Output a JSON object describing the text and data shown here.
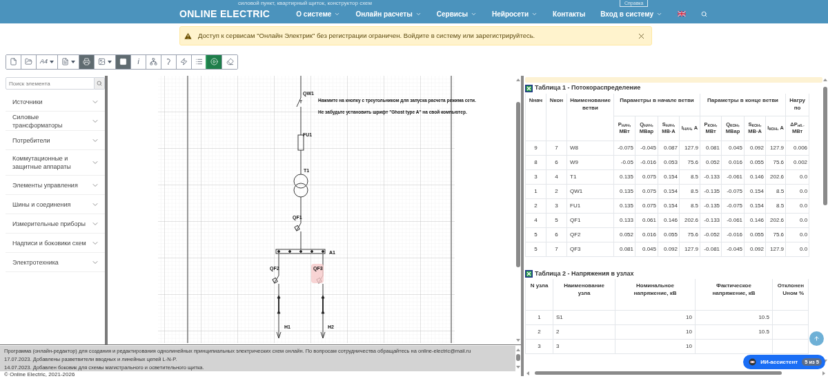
{
  "behind_header": {
    "text": "силовой пункт, квартирный щиток, конструктор схем",
    "button": "Справка"
  },
  "nav": {
    "logo": "ONLINE ELECTRIC",
    "items": [
      {
        "kind": "link",
        "label": "О системе",
        "dropdown": true
      },
      {
        "kind": "link",
        "label": "Онлайн расчеты",
        "dropdown": true
      },
      {
        "kind": "link",
        "label": "Сервисы",
        "dropdown": true
      },
      {
        "kind": "link",
        "label": "Нейросети",
        "dropdown": true
      },
      {
        "kind": "link",
        "label": "Контакты",
        "dropdown": false
      },
      {
        "kind": "link",
        "label": "Вход в систему",
        "dropdown": true
      },
      {
        "kind": "flag"
      },
      {
        "kind": "search"
      }
    ]
  },
  "alert": {
    "text": "Доступ к сервисам \"Онлайн Электрик\" без регистрации ограничен. Войдите в систему или зарегистрируйтесь."
  },
  "toolbar": [
    {
      "kind": "icon",
      "selected": false,
      "dropdown": false
    },
    {
      "kind": "icon",
      "selected": false,
      "dropdown": false
    },
    {
      "kind": "text",
      "label": "A4",
      "selected": false,
      "dropdown": true
    },
    {
      "kind": "icon",
      "selected": false,
      "dropdown": true
    },
    {
      "kind": "icon",
      "selected": true,
      "dropdown": false
    },
    {
      "kind": "icon",
      "selected": false,
      "dropdown": true
    },
    {
      "kind": "icon",
      "selected": true,
      "dropdown": false
    },
    {
      "kind": "text",
      "label": "i",
      "selected": false,
      "dropdown": false
    },
    {
      "kind": "icon",
      "selected": false,
      "dropdown": false
    },
    {
      "kind": "icon",
      "selected": false,
      "dropdown": false
    },
    {
      "kind": "icon",
      "selected": false,
      "dropdown": false
    },
    {
      "kind": "icon",
      "selected": false,
      "dropdown": false
    },
    {
      "kind": "run",
      "selected": true,
      "dropdown": false
    },
    {
      "kind": "icon",
      "selected": false,
      "dropdown": false
    }
  ],
  "sidebar": {
    "search_placeholder": "Поиск элемента",
    "items": [
      {
        "label": "Источники",
        "expanded": false
      },
      {
        "label": "Силовые трансформаторы",
        "expanded": false
      },
      {
        "label": "Потребители",
        "expanded": false
      },
      {
        "label": "Коммутационные и защитные аппараты",
        "expanded": false
      },
      {
        "label": "Элементы управления",
        "expanded": false
      },
      {
        "label": "Шины и соединения",
        "expanded": false
      },
      {
        "label": "Измерительные приборы",
        "expanded": false
      },
      {
        "label": "Надписи и боковики схем",
        "expanded": false
      },
      {
        "label": "Электротехника",
        "expanded": false
      }
    ]
  },
  "diagram": {
    "notes": [
      "Нажмите на кнопку с треугольником для запуска расчета режима сети.",
      "Не забудьте установить шрифт \"Ghost type A\" на свой компьютер."
    ],
    "labels": [
      {
        "text": "QW1",
        "selected": false
      },
      {
        "text": "FU1",
        "selected": false
      },
      {
        "text": "T1",
        "selected": false
      },
      {
        "text": "QF1",
        "selected": false
      },
      {
        "text": "A1",
        "selected": false
      },
      {
        "text": "QF2",
        "selected": false
      },
      {
        "text": "QF3",
        "selected": true
      },
      {
        "text": "H1",
        "selected": false
      },
      {
        "text": "H2",
        "selected": false
      }
    ]
  },
  "info": [
    "Программа (онлайн-редактор) для создания и редактирования однолинейных принципиальных электрических схем онлайн. По вопросам сотрудничества обращайтесь на online-electric@mail.ru",
    "17.07.2023. Добавлены разветвители вводных и линейных цепей L-N-P.",
    "14.07.2023. Добавлен боковик для схемы магистрального и осветительного щитка."
  ],
  "footer": "© Online Electric, 2021-2026",
  "table1": {
    "title": "Таблица 1 - Потокораспределение",
    "columns": [
      "Nнач",
      "Nкон",
      "Наименование ветви"
    ],
    "groups": [
      {
        "label": "Параметры в начале ветви",
        "columns": [
          "P$_{НАЧ}$, МВт",
          "Q$_{НАЧ}$, МВар",
          "S$_{НАЧ}$, МВ·А",
          "I$_{НАЧ}$, А"
        ]
      },
      {
        "label": "Параметры в конце ветви",
        "columns": [
          "P$_{КОН}$, МВт",
          "Q$_{КОН}$, МВар",
          "S$_{КОН}$, МВ·А",
          "I$_{КОН}$, А"
        ]
      },
      {
        "label": "Нагру по",
        "columns": [
          "ΔP$_{нб.-}$ МВт"
        ]
      }
    ],
    "rows": [
      [
        "9",
        "7",
        "W8",
        "-0.075",
        "-0.045",
        "0.087",
        "127.9",
        "0.081",
        "0.045",
        "0.092",
        "127.9",
        "0.006"
      ],
      [
        "8",
        "6",
        "W9",
        "-0.05",
        "-0.016",
        "0.053",
        "75.6",
        "0.052",
        "0.016",
        "0.055",
        "75.6",
        "0.002"
      ],
      [
        "3",
        "4",
        "T1",
        "0.135",
        "0.075",
        "0.154",
        "8.5",
        "-0.133",
        "-0.061",
        "0.146",
        "202.6",
        "0.0"
      ],
      [
        "1",
        "2",
        "QW1",
        "0.135",
        "0.075",
        "0.154",
        "8.5",
        "-0.135",
        "-0.075",
        "0.154",
        "8.5",
        "0.0"
      ],
      [
        "2",
        "3",
        "FU1",
        "0.135",
        "0.075",
        "0.154",
        "8.5",
        "-0.135",
        "-0.075",
        "0.154",
        "8.5",
        "0.0"
      ],
      [
        "4",
        "5",
        "QF1",
        "0.133",
        "0.061",
        "0.146",
        "202.6",
        "-0.133",
        "-0.061",
        "0.146",
        "202.6",
        "0.0"
      ],
      [
        "5",
        "6",
        "QF2",
        "0.052",
        "0.016",
        "0.055",
        "75.6",
        "-0.052",
        "-0.016",
        "0.055",
        "75.6",
        "0.0"
      ],
      [
        "5",
        "7",
        "QF3",
        "0.081",
        "0.045",
        "0.092",
        "127.9",
        "-0.081",
        "-0.045",
        "0.092",
        "127.9",
        "0.0"
      ]
    ]
  },
  "table2": {
    "title": "Таблица 2 - Напряжения в узлах",
    "columns": [
      "N узла",
      "Наименование узла",
      "Номинальное напряжение, кВ",
      "Фактическое напряжение, кВ",
      "Отклонен Uном %"
    ],
    "rows": [
      {
        "n": "1",
        "name": "S1",
        "nominal": "10",
        "actual": "10.5"
      },
      {
        "n": "2",
        "name": "2",
        "nominal": "10",
        "actual": "10.5"
      },
      {
        "n": "3",
        "name": "3",
        "nominal": "10"
      }
    ]
  },
  "assistant": {
    "label": "ИИ-ассистент",
    "badge": "5 из 5"
  }
}
